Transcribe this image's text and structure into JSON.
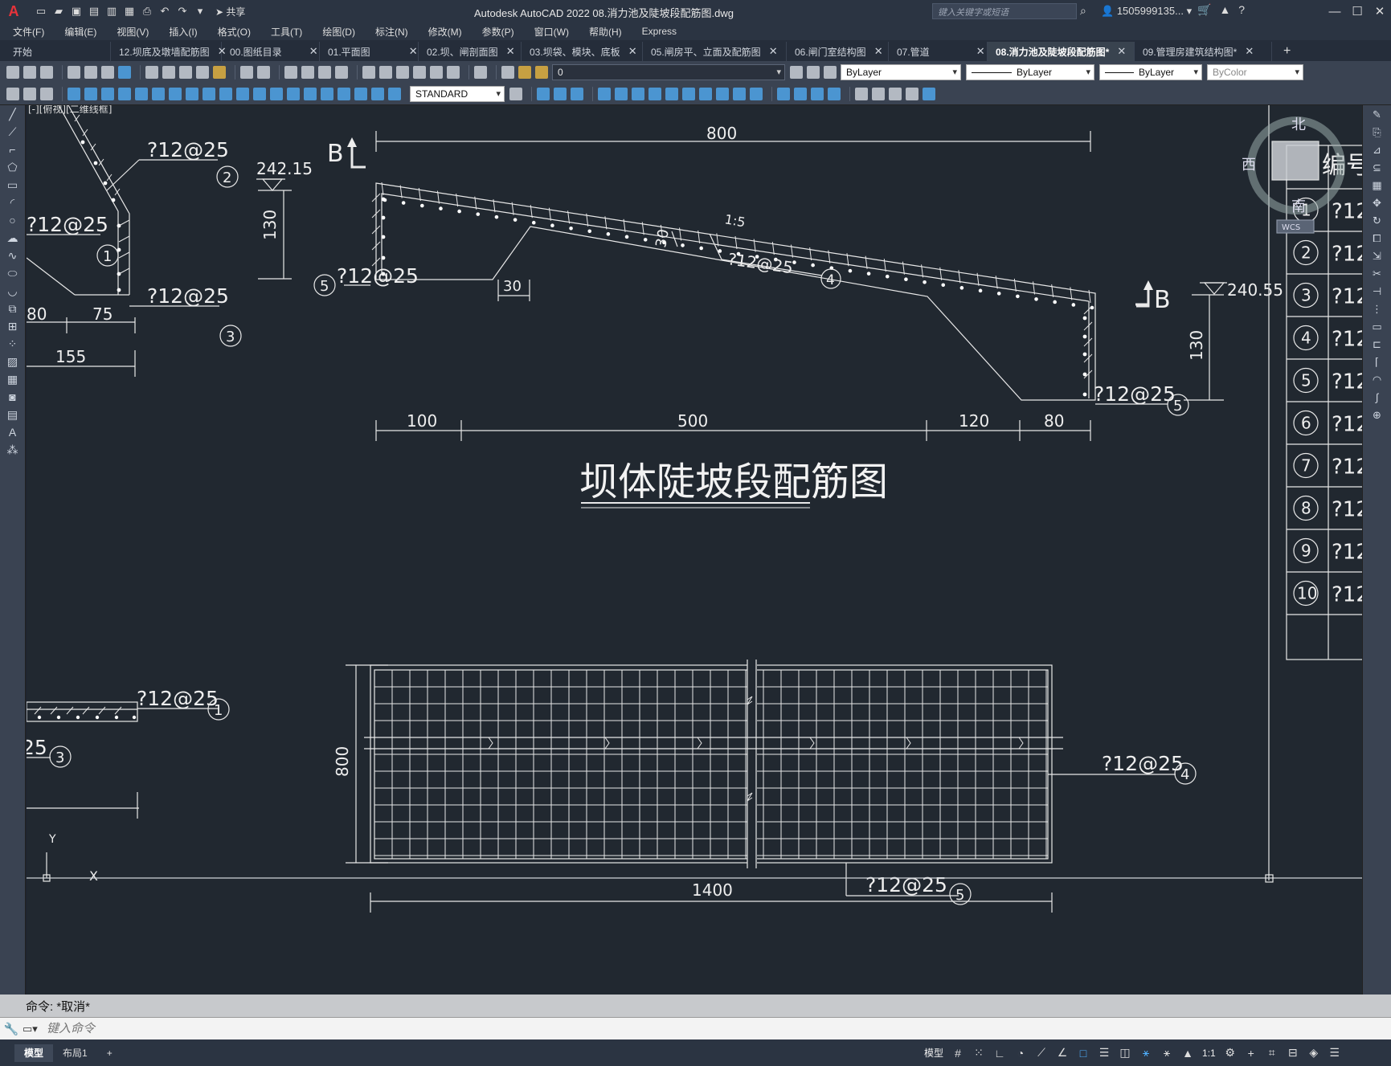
{
  "app": {
    "title": "Autodesk AutoCAD 2022    08.消力池及陡坡段配筋图.dwg",
    "share_label": "共享",
    "search_placeholder": "键入关键字或短语",
    "user": "1505999135...",
    "logo_letter": "A"
  },
  "menu": [
    "文件(F)",
    "编辑(E)",
    "视图(V)",
    "插入(I)",
    "格式(O)",
    "工具(T)",
    "绘图(D)",
    "标注(N)",
    "修改(M)",
    "参数(P)",
    "窗口(W)",
    "帮助(H)",
    "Express"
  ],
  "tabs": [
    {
      "label": "开始",
      "active": false,
      "closable": false
    },
    {
      "label": "12.坝底及墩墙配筋图",
      "active": false,
      "closable": true
    },
    {
      "label": "00.图纸目录",
      "active": false,
      "closable": true
    },
    {
      "label": "01.平面图",
      "active": false,
      "closable": true
    },
    {
      "label": "02.坝、闸剖面图",
      "active": false,
      "closable": true
    },
    {
      "label": "03.坝袋、模块、底板",
      "active": false,
      "closable": true
    },
    {
      "label": "05.闸房平、立面及配筋图",
      "active": false,
      "closable": true
    },
    {
      "label": "06.闸门室结构图",
      "active": false,
      "closable": true
    },
    {
      "label": "07.管道",
      "active": false,
      "closable": true
    },
    {
      "label": "08.消力池及陡坡段配筋图*",
      "active": true,
      "closable": true
    },
    {
      "label": "09.管理房建筑结构图*",
      "active": false,
      "closable": true
    }
  ],
  "toolbar": {
    "layer_value": "0",
    "text_style": "STANDARD",
    "color": "ByLayer",
    "linetype": "ByLayer",
    "lineweight": "ByLayer",
    "plotstyle": "ByColor"
  },
  "viewport_label": "[-][俯视][二维线框]",
  "viewcube": {
    "north": "北",
    "west": "西",
    "south": "南",
    "wcs": "WCS"
  },
  "drawing": {
    "title": "坝体陡坡段配筋图",
    "rebar": "?12@25",
    "dims_top": [
      "800",
      "130",
      "130",
      "30",
      "30",
      "1:5"
    ],
    "dims_bottom_row": [
      "100",
      "500",
      "120",
      "80"
    ],
    "dims_left": [
      "80",
      "75",
      "155"
    ],
    "elevations": [
      "242.15",
      "240.55"
    ],
    "section_label": "B",
    "markers": [
      "1",
      "2",
      "3",
      "4",
      "5"
    ],
    "plan_dims": [
      "800",
      "1400"
    ],
    "table_header": "编号规格",
    "table_rows": [
      {
        "no": "1",
        "spec": "?12"
      },
      {
        "no": "2",
        "spec": "?12"
      },
      {
        "no": "3",
        "spec": "?12"
      },
      {
        "no": "4",
        "spec": "?12"
      },
      {
        "no": "5",
        "spec": "?12"
      },
      {
        "no": "6",
        "spec": "?12"
      },
      {
        "no": "7",
        "spec": "?12"
      },
      {
        "no": "8",
        "spec": "?12"
      },
      {
        "no": "9",
        "spec": "?12"
      },
      {
        "no": "10",
        "spec": "?12"
      }
    ],
    "ucs_x": "X",
    "ucs_y": "Y"
  },
  "command": {
    "history": "命令: *取消*",
    "placeholder": "键入命令"
  },
  "status": {
    "layout_tabs": [
      "模型",
      "布局1"
    ],
    "model_label": "模型",
    "scale": "1:1"
  }
}
